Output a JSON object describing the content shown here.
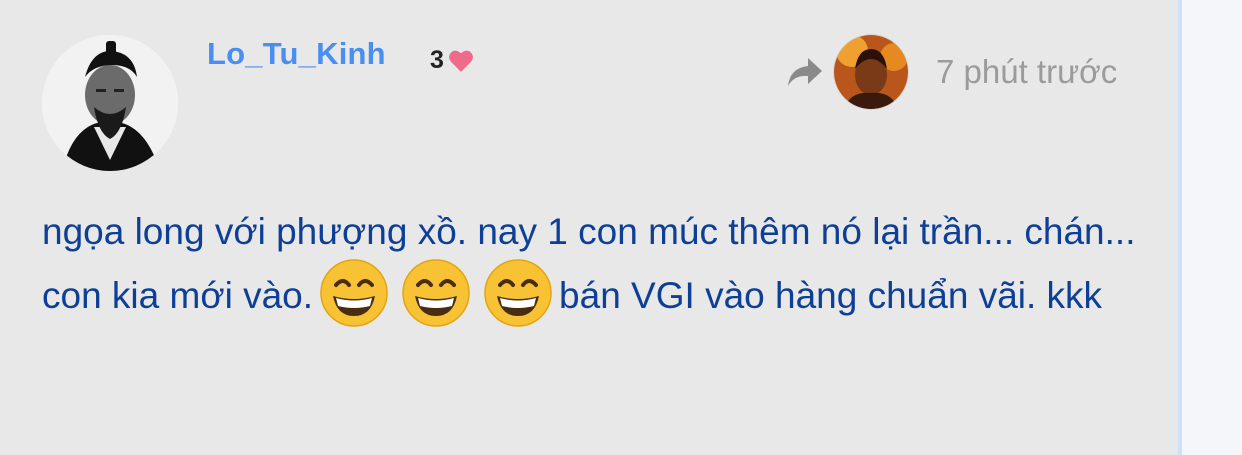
{
  "post": {
    "author": "Lo_Tu_Kinh",
    "likes": "3",
    "timestamp": "7 phút trước",
    "message_part1": "ngọa long với phượng xồ. nay 1 con múc thêm nó lại trần... chán... con kia mới vào.",
    "message_part2": "bán VGI vào hàng chuẩn vãi. kkk",
    "emoji_count": 3
  },
  "icons": {
    "heart": "heart-icon",
    "share": "share-icon",
    "emoji": "grinning-face-emoji"
  },
  "colors": {
    "username": "#4a8ef0",
    "message": "#0e3f96",
    "timestamp": "#9b9b9b",
    "heart": "#f06a8c",
    "card_bg": "#e8e8e8"
  }
}
